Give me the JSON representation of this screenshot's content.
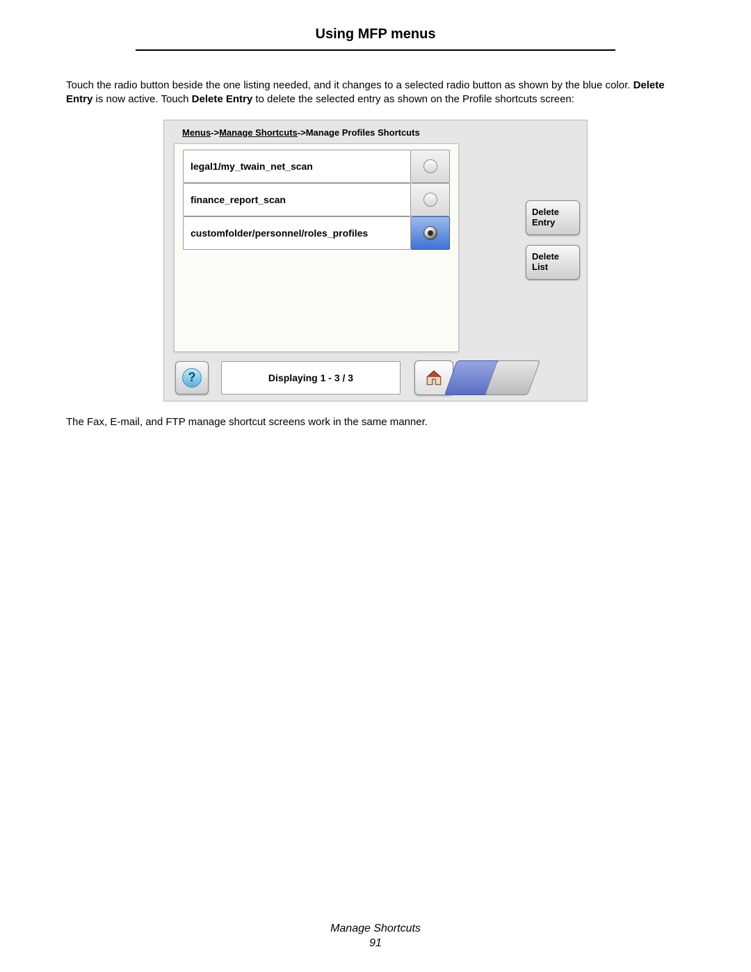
{
  "page": {
    "title": "Using MFP menus",
    "footer_label": "Manage Shortcuts",
    "page_number": "91"
  },
  "paragraphs": {
    "p1_a": "Touch the radio button beside the one listing needed, and it changes to a selected radio button as shown by the blue color. ",
    "p1_b1": "Delete Entry",
    "p1_c": " is now active. Touch ",
    "p1_b2": "Delete Entry",
    "p1_d": " to delete the selected entry as shown on the Profile shortcuts screen:",
    "p2": "The Fax, E-mail, and FTP manage shortcut screens work in the same manner."
  },
  "breadcrumb": {
    "a1": "Menus",
    "sep1": "->",
    "a2": "Manage Shortcuts",
    "sep2": "->",
    "tail": "Manage Profiles Shortcuts"
  },
  "list": {
    "items": [
      {
        "label": "legal1/my_twain_net_scan",
        "selected": false
      },
      {
        "label": "finance_report_scan",
        "selected": false
      },
      {
        "label": "customfolder/personnel/roles_profiles",
        "selected": true
      }
    ]
  },
  "buttons": {
    "delete_entry": "Delete\nEntry",
    "delete_list": "Delete\nList"
  },
  "status": {
    "displaying": "Displaying 1 - 3 / 3"
  },
  "icons": {
    "help": "?",
    "home": "home"
  }
}
